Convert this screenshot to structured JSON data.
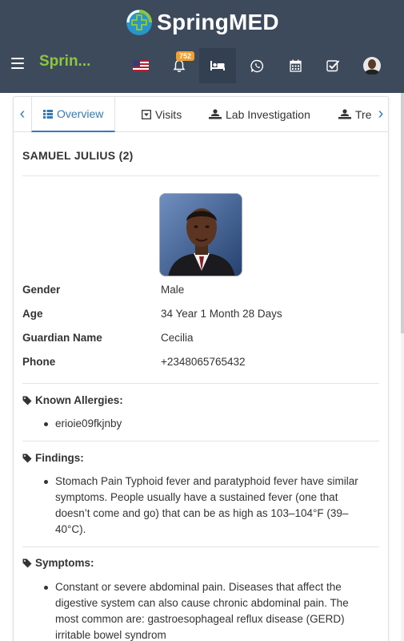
{
  "header": {
    "logo_text": "SpringMED",
    "brand_short": "Sprin...",
    "notification_count": "752",
    "icons": [
      "us-flag-icon",
      "bell-icon",
      "bed-icon",
      "whatsapp-icon",
      "calendar-icon",
      "checkbox-icon",
      "user-avatar"
    ]
  },
  "tabs": [
    {
      "label": "Overview",
      "icon": "grid-icon",
      "active": true
    },
    {
      "label": "Visits",
      "icon": "caret-box-icon"
    },
    {
      "label": "Lab Investigation",
      "icon": "doctor-icon"
    },
    {
      "label": "Treatm",
      "icon": "doctor-icon"
    }
  ],
  "patient": {
    "name": "SAMUEL JULIUS (2)",
    "fields": [
      {
        "label": "Gender",
        "value": "Male"
      },
      {
        "label": "Age",
        "value": "34 Year 1 Month 28 Days"
      },
      {
        "label": "Guardian Name",
        "value": "Cecilia"
      },
      {
        "label": "Phone",
        "value": "+2348065765432"
      }
    ]
  },
  "sections": {
    "allergies": {
      "title": "Known Allergies:",
      "items": [
        "erioie09fkjnby"
      ]
    },
    "findings": {
      "title": "Findings:",
      "items": [
        "Stomach Pain Typhoid fever and paratyphoid fever have similar symptoms. People usually have a sustained fever (one that doesn’t come and go) that can be as high as 103–104°F (39–40°C)."
      ]
    },
    "symptoms": {
      "title": "Symptoms:",
      "items": [
        "Constant or severe abdominal pain. Diseases that affect the digestive system can also cause chronic abdominal pain. The most common are: gastroesophageal reflux disease (GERD) irritable bowel syndrom"
      ]
    }
  },
  "colors": {
    "header_bg": "#3d4a5c",
    "brand_green": "#8cc63f",
    "accent_blue": "#337ab7",
    "badge_orange": "#f0a030"
  }
}
